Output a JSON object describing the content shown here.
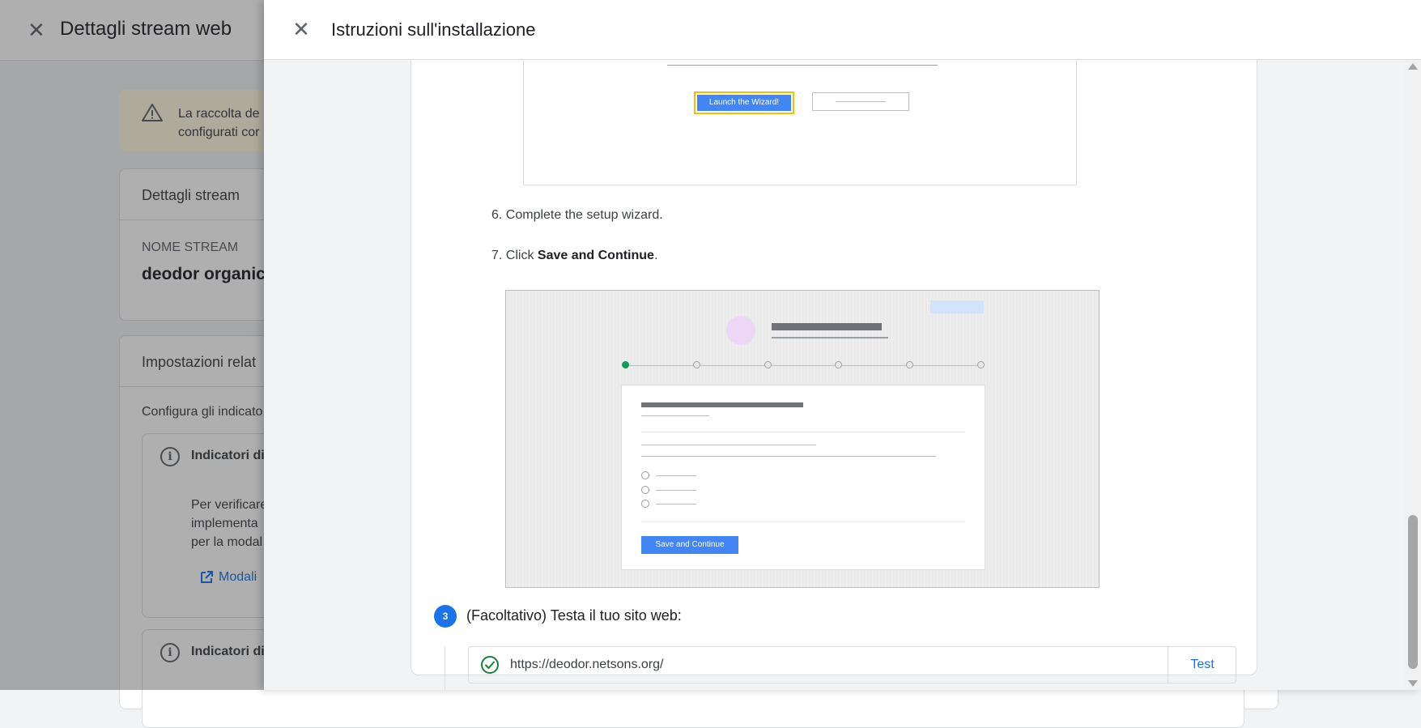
{
  "background_page": {
    "close_icon": "close-icon",
    "title": "Dettagli stream web",
    "warning": {
      "icon": "warning-icon",
      "line1": "La raccolta de",
      "line2": "configurati cor"
    },
    "stream_details": {
      "heading": "Dettagli stream",
      "name_label": "NOME STREAM",
      "name_value": "deodor organic"
    },
    "settings": {
      "heading": "Impostazioni relat",
      "description": "Configura gli indicato",
      "indicator1": {
        "title": "Indicatori di",
        "text_line1": "Per verificare",
        "text_line2": "implementa",
        "text_line3": "per la modal",
        "link": "Modali"
      },
      "indicator2": {
        "title": "Indicatori di"
      }
    }
  },
  "panel": {
    "close_icon": "close-icon",
    "title": "Istruzioni sull'installazione",
    "illustration1": {
      "launch_button": "Launch the Wizard!"
    },
    "step6": "6. Complete the setup wizard.",
    "step7": {
      "prefix": "7. Click ",
      "bold": "Save and Continue",
      "suffix": "."
    },
    "illustration2": {
      "save_button": "Save and Continue"
    },
    "step3": {
      "number": "3",
      "title": "(Facoltativo) Testa il tuo sito web:",
      "url": "https://deodor.netsons.org/",
      "test_button": "Test",
      "status_icon": "check-circle-icon"
    }
  },
  "colors": {
    "accent": "#1a73e8",
    "success": "#188038",
    "warning_bg": "#fef7e0",
    "wizard_button": "#4285f4"
  }
}
